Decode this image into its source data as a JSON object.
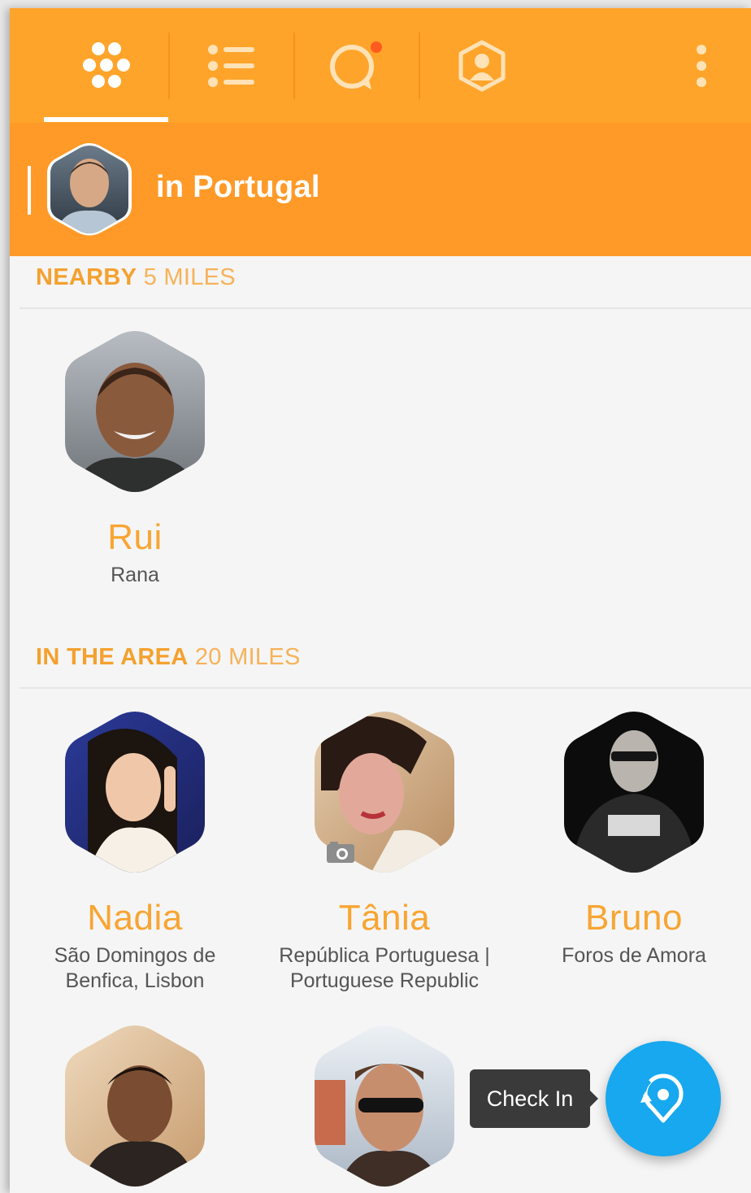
{
  "app": {
    "accent": "#ffa42b",
    "header_color": "#ff9a28",
    "fab_color": "#17a8ef"
  },
  "tabs": [
    {
      "icon": "honeycomb-icon",
      "selected": true
    },
    {
      "icon": "list-icon",
      "selected": false
    },
    {
      "icon": "chat-bubble-icon",
      "selected": false,
      "notification_dot": true
    },
    {
      "icon": "profile-hexagon-icon",
      "selected": false
    }
  ],
  "overflow_icon": "more-vertical-icon",
  "location_header": {
    "title": "in Portugal"
  },
  "sections": {
    "nearby": {
      "label": "NEARBY",
      "distance": "5 MILES",
      "people": [
        {
          "name": "Rui",
          "location": "Rana"
        }
      ]
    },
    "area": {
      "label": "IN THE AREA",
      "distance": "20 MILES",
      "people": [
        {
          "name": "Nadia",
          "location": "São Domingos de Benfica, Lisbon"
        },
        {
          "name": "Tânia",
          "location": "República Portuguesa | Portuguese Republic",
          "badge_icon": "camera-icon"
        },
        {
          "name": "Bruno",
          "location": "Foros de Amora"
        },
        {
          "name": "",
          "location": ""
        },
        {
          "name": "",
          "location": ""
        }
      ]
    }
  },
  "check_in": {
    "tooltip": "Check In",
    "icon": "check-in-pin-icon"
  }
}
